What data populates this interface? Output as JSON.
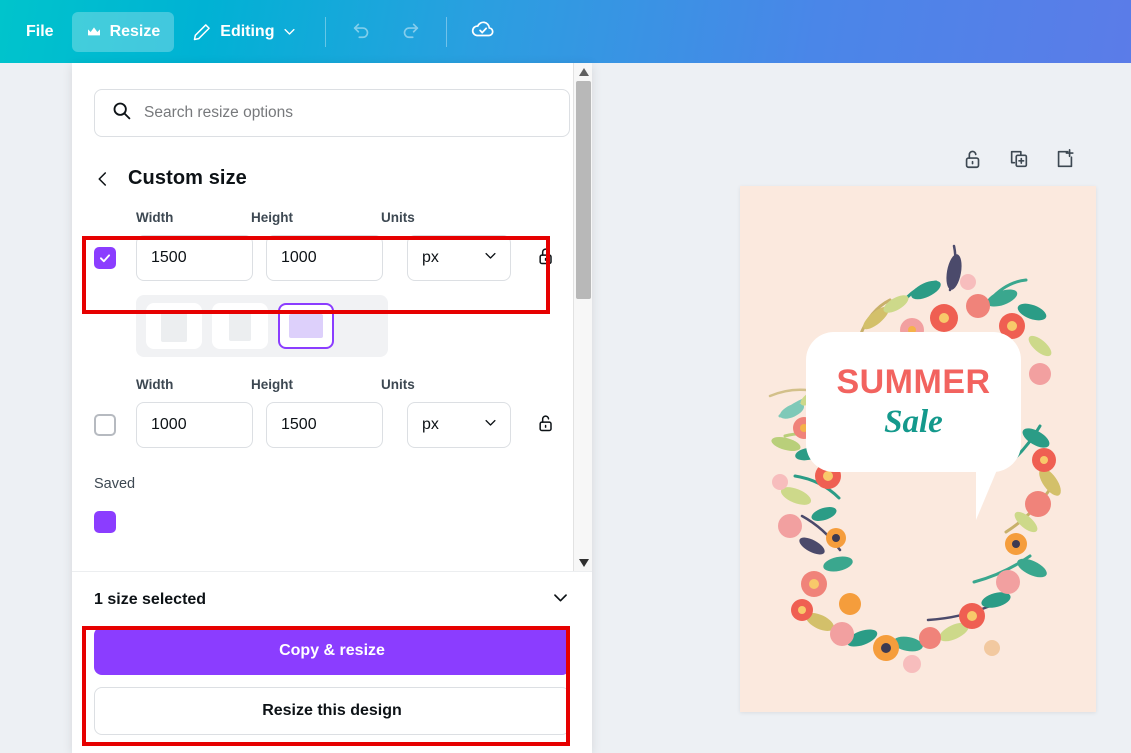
{
  "topbar": {
    "file_label": "File",
    "resize_label": "Resize",
    "editing_label": "Editing",
    "undo_name": "undo-icon",
    "redo_name": "redo-icon",
    "saved_name": "cloud-saved-icon",
    "crown_name": "crown-icon",
    "pencil_name": "pencil-icon",
    "chevron_name": "chevron-down-icon"
  },
  "panel": {
    "search": {
      "placeholder": "Search resize options",
      "value": ""
    },
    "breadcrumb_title": "Custom size",
    "column_labels": {
      "width": "Width",
      "height": "Height",
      "units": "Units"
    },
    "size_rows": [
      {
        "checked": true,
        "width": "1500",
        "height": "1000",
        "units": "px",
        "locked": false
      },
      {
        "checked": false,
        "width": "1000",
        "height": "1500",
        "units": "px",
        "locked": false
      }
    ],
    "orientation": {
      "options": [
        "portrait",
        "square",
        "landscape"
      ],
      "selected": 2
    },
    "saved_label": "Saved",
    "selected_summary": "1 size selected",
    "buttons": {
      "primary": "Copy & resize",
      "secondary": "Resize this design"
    }
  },
  "canvas": {
    "tools": [
      "lock-icon",
      "duplicate-page-icon",
      "add-page-icon"
    ],
    "design": {
      "headline": "SUMMER",
      "subline": "Sale",
      "background_color": "#FBE9DE",
      "headline_color": "#F2635F",
      "subline_color": "#14998C"
    }
  },
  "colors": {
    "brand_purple": "#8B3DFF",
    "annotation_red": "#E60000",
    "toolbar_start": "#00C4CC",
    "toolbar_end": "#5B7CE8"
  }
}
